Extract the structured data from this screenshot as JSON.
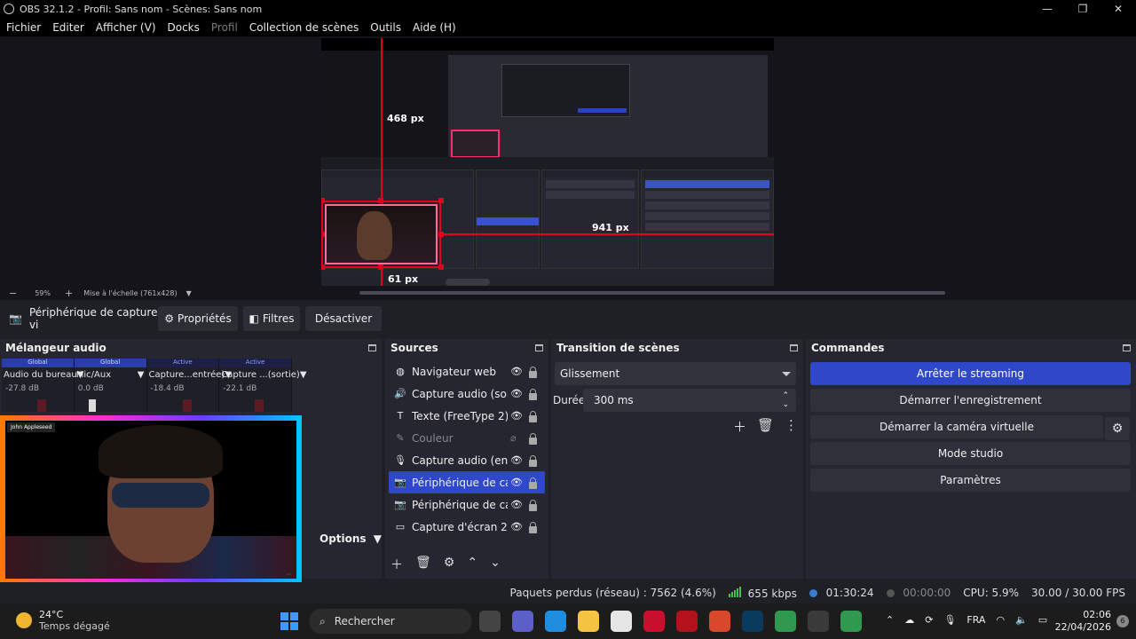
{
  "window": {
    "title": "OBS 32.1.2 - Profil: Sans nom - Scènes: Sans nom",
    "controls": [
      "—",
      "❐",
      "✕"
    ]
  },
  "menu": [
    "Fichier",
    "Editer",
    "Afficher (V)",
    "Docks",
    "Profil",
    "Collection de scènes",
    "Outils",
    "Aide (H)"
  ],
  "preview": {
    "measure_top": "468 px",
    "measure_right": "941 px",
    "measure_bottom": "61 px",
    "zoom": "59%",
    "scale_mode": "Mise à l'échelle (761x428)"
  },
  "source_toolbar": {
    "selected_source": "Périphérique de capture vi",
    "properties": "Propriétés",
    "filters": "Filtres",
    "deactivate": "Désactiver"
  },
  "mixer": {
    "title": "Mélangeur audio",
    "channels": [
      {
        "status": "Global",
        "name": "Audio du bureau",
        "db": "-27.8 dB",
        "active": false
      },
      {
        "status": "Global",
        "name": "Mic/Aux",
        "db": "0.0 dB",
        "active": false
      },
      {
        "status": "Active",
        "name": "Capture...entrée)",
        "db": "-18.4 dB",
        "active": true
      },
      {
        "status": "Active",
        "name": "Capture ...(sortie)",
        "db": "-22.1 dB",
        "active": true
      }
    ],
    "options_label": "Options"
  },
  "webcam_overlay": {
    "name_tag": "John Appleseed"
  },
  "sources": {
    "title": "Sources",
    "items": [
      {
        "label": "Navigateur web",
        "icon": "globe-icon",
        "glyph": "◍"
      },
      {
        "label": "Capture audio (sortie",
        "icon": "speaker-icon",
        "glyph": "🔊"
      },
      {
        "label": "Texte (FreeType 2)",
        "icon": "text-icon",
        "glyph": "T"
      },
      {
        "label": "Couleur",
        "icon": "paint-icon",
        "glyph": "✎"
      },
      {
        "label": "Capture audio (entré",
        "icon": "microphone-icon",
        "glyph": "🎙"
      },
      {
        "label": "Périphérique de capt",
        "icon": "camera-icon",
        "glyph": "📷"
      },
      {
        "label": "Périphérique de capt",
        "icon": "camera-icon",
        "glyph": "📷"
      },
      {
        "label": "Capture d'écran 2",
        "icon": "monitor-icon",
        "glyph": "▭"
      }
    ]
  },
  "transition": {
    "title": "Transition de scènes",
    "selected": "Glissement",
    "duration_label": "Durée",
    "duration_value": "300 ms"
  },
  "controls": {
    "title": "Commandes",
    "stop_streaming": "Arrêter le streaming",
    "start_recording": "Démarrer l'enregistrement",
    "start_virtual_cam": "Démarrer la caméra virtuelle",
    "studio_mode": "Mode studio",
    "settings": "Paramètres"
  },
  "status_bar": {
    "dropped": "Paquets perdus (réseau) : 7562 (4.6%)",
    "bitrate": "655 kbps",
    "stream_time": "01:30:24",
    "record_time": "00:00:00",
    "cpu": "CPU: 5.9%",
    "fps": "30.00 / 30.00 FPS"
  },
  "taskbar": {
    "temp": "24°C",
    "weather": "Temps dégagé",
    "search": "Rechercher",
    "language": "FRA",
    "time": "02:06",
    "date": "22/04/2026",
    "notifications": "6"
  }
}
